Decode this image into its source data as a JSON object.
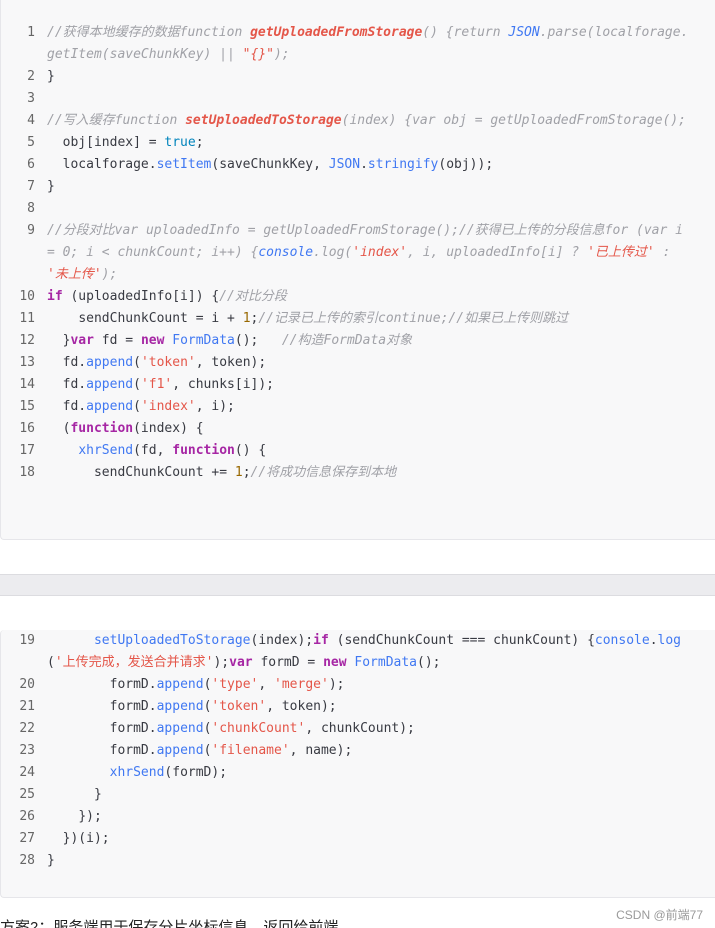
{
  "code_block_1": {
    "lines": [
      {
        "n": "1",
        "html": "<span class=\"cm\">//获得本地缓存的数据</span><span class=\"kwi\" style=\"font-weight:normal;color:#a0a1a7\">function </span><span class=\"fn\">getUploadedFromStorage</span><span class=\"cm\">() {return </span><span class=\"bl\">JSON</span><span class=\"cm\">.parse(localforage.getItem(saveChunkKey) || </span><span class=\"stri\">\"{}\"</span><span class=\"cm\">);</span>"
      },
      {
        "n": "2",
        "html": "}"
      },
      {
        "n": "3",
        "html": ""
      },
      {
        "n": "4",
        "html": "<span class=\"cm\">//写入缓存function </span><span class=\"fn\">setUploadedToStorage</span><span class=\"cm\">(index) {var obj = getUploadedFromStorage();</span>"
      },
      {
        "n": "5",
        "html": "  obj[index] = <span class=\"lit\">true</span>;"
      },
      {
        "n": "6",
        "html": "  localforage.<span class=\"fnc\">setItem</span>(saveChunkKey, <span class=\"fnc\">JSON</span>.<span class=\"fnc\">stringify</span>(obj));"
      },
      {
        "n": "7",
        "html": "}"
      },
      {
        "n": "8",
        "html": ""
      },
      {
        "n": "9",
        "html": "<span class=\"cm\">//分段对比var uploadedInfo = getUploadedFromStorage();//获得已上传的分段信息for (var i = 0; i &lt; chunkCount; i++) {</span><span class=\"bl\">console</span><span class=\"cm\">.log(</span><span class=\"stri\">'index'</span><span class=\"cm\">, i, uploadedInfo[i] ? </span><span class=\"stri\">'已上传过'</span><span class=\"cm\"> : </span><span class=\"stri\">'未上传'</span><span class=\"cm\">);</span>"
      },
      {
        "n": "10",
        "html": "<span class=\"kw\">if</span> (uploadedInfo[i]) {<span class=\"cm\">//对比分段</span>"
      },
      {
        "n": "11",
        "html": "    sendChunkCount = i + <span class=\"num\">1</span>;<span class=\"cm\">//记录已上传的索引continue;//如果已上传则跳过</span>"
      },
      {
        "n": "12",
        "html": "  }<span class=\"kw\">var</span> fd = <span class=\"kw\">new</span> <span class=\"fnc\">FormData</span>();   <span class=\"cm\">//构造FormData对象</span>"
      },
      {
        "n": "13",
        "html": "  fd.<span class=\"fnc\">append</span>(<span class=\"str\">'token'</span>, token);"
      },
      {
        "n": "14",
        "html": "  fd.<span class=\"fnc\">append</span>(<span class=\"str\">'f1'</span>, chunks[i]);"
      },
      {
        "n": "15",
        "html": "  fd.<span class=\"fnc\">append</span>(<span class=\"str\">'index'</span>, i);"
      },
      {
        "n": "16",
        "html": "  (<span class=\"kw\">function</span>(index) {"
      },
      {
        "n": "17",
        "html": "    <span class=\"fnc\">xhrSend</span>(fd, <span class=\"kw\">function</span>() {"
      },
      {
        "n": "18",
        "html": "      sendChunkCount += <span class=\"num\">1</span>;<span class=\"cm\">//将成功信息保存到本地</span>"
      }
    ]
  },
  "code_block_2": {
    "lines": [
      {
        "n": "19",
        "html": "      <span class=\"fnc\">setUploadedToStorage</span>(index);<span class=\"kw\">if</span> (sendChunkCount === chunkCount) {<span class=\"fnc\">console</span>.<span class=\"fnc\">log</span>(<span class=\"str\">'上传完成，发送合并请求'</span>);<span class=\"kw\">var</span> formD = <span class=\"kw\">new</span> <span class=\"fnc\">FormData</span>();"
      },
      {
        "n": "20",
        "html": "        formD.<span class=\"fnc\">append</span>(<span class=\"str\">'type'</span>, <span class=\"str\">'merge'</span>);"
      },
      {
        "n": "21",
        "html": "        formD.<span class=\"fnc\">append</span>(<span class=\"str\">'token'</span>, token);"
      },
      {
        "n": "22",
        "html": "        formD.<span class=\"fnc\">append</span>(<span class=\"str\">'chunkCount'</span>, chunkCount);"
      },
      {
        "n": "23",
        "html": "        formD.<span class=\"fnc\">append</span>(<span class=\"str\">'filename'</span>, name);"
      },
      {
        "n": "24",
        "html": "        <span class=\"fnc\">xhrSend</span>(formD);"
      },
      {
        "n": "25",
        "html": "      }"
      },
      {
        "n": "26",
        "html": "    });"
      },
      {
        "n": "27",
        "html": "  })(i);"
      },
      {
        "n": "28",
        "html": "}"
      }
    ]
  },
  "footer": {
    "bottom_text": "方案2：服务端用于保存分片坐标信息，返回给前端",
    "watermark": "CSDN @前端77"
  }
}
